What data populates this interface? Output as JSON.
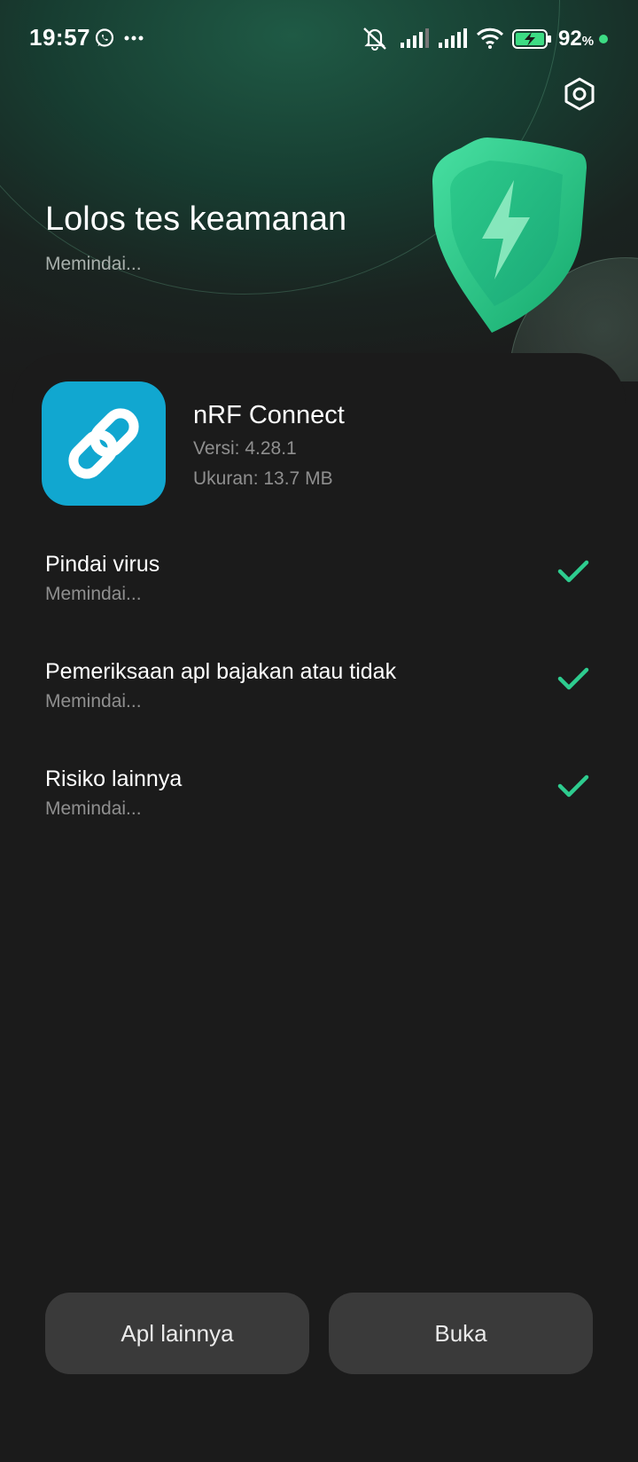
{
  "status_bar": {
    "time": "19:57",
    "battery_percent": "92",
    "battery_unit": "%",
    "icons": [
      "whatsapp-icon",
      "more-icon",
      "mute-icon",
      "signal-icon",
      "signal-icon",
      "wifi-icon",
      "battery-charging-icon"
    ]
  },
  "header": {
    "title": "Lolos tes keamanan",
    "subtitle": "Memindai..."
  },
  "app": {
    "name": "nRF Connect",
    "version": "Versi: 4.28.1",
    "size": "Ukuran: 13.7 MB",
    "icon_color": "#11a7d0"
  },
  "checks": [
    {
      "title": "Pindai virus",
      "status": "Memindai..."
    },
    {
      "title": "Pemeriksaan apl bajakan atau tidak",
      "status": "Memindai..."
    },
    {
      "title": "Risiko lainnya",
      "status": "Memindai..."
    }
  ],
  "buttons": {
    "more_apps": "Apl lainnya",
    "open": "Buka"
  },
  "colors": {
    "accent": "#2ecc8f",
    "background": "#1b1b1b",
    "button": "#3a3a3a"
  }
}
